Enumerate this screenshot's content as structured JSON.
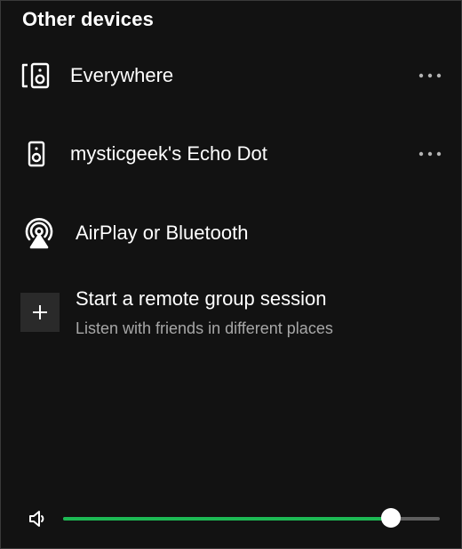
{
  "header": {
    "title": "Other devices"
  },
  "devices": [
    {
      "label": "Everywhere",
      "icon": "speaker-group-icon",
      "has_more": true
    },
    {
      "label": "mysticgeek's Echo Dot",
      "icon": "speaker-icon",
      "has_more": true
    },
    {
      "label": "AirPlay or Bluetooth",
      "icon": "airplay-icon",
      "has_more": false
    }
  ],
  "group_session": {
    "title": "Start a remote group session",
    "subtitle": "Listen with friends in different places",
    "icon": "plus-icon"
  },
  "volume": {
    "icon": "volume-icon",
    "level": 0.87
  },
  "colors": {
    "background": "#121212",
    "accent": "#1db954",
    "text": "#ffffff",
    "subtext": "#a7a7a7"
  }
}
